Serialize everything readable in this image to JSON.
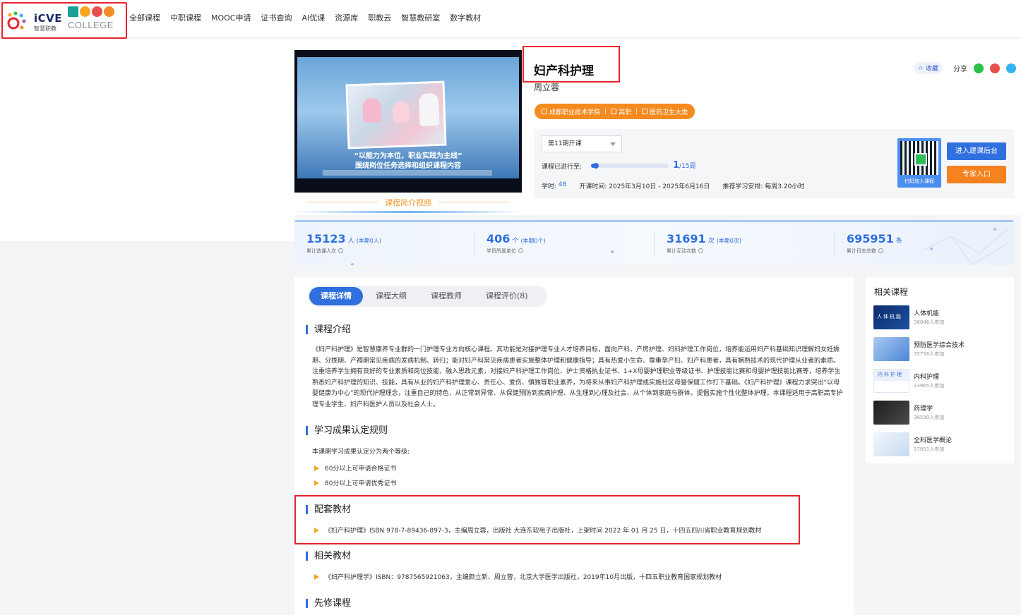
{
  "logo": {
    "icve_text": "iCVE",
    "icve_sub": "智慧职教",
    "mooc_text": "MOOC",
    "college_text": "COLLEGE"
  },
  "nav": [
    "全部课程",
    "中职课程",
    "MOOC申请",
    "证书查询",
    "AI优课",
    "资源库",
    "职教云",
    "智慧教研室",
    "数字教材"
  ],
  "video": {
    "caption_line1": "“以能力为本位，职业实践为主线”",
    "caption_line2": "围绕岗位任务选择和组织课程内容",
    "title": "课程简介视频"
  },
  "course": {
    "title": "妇产科护理",
    "teacher": "周立蓉",
    "tags": [
      "成都职业技术学院",
      "高职",
      "医药卫生大类"
    ],
    "favorite": "收藏",
    "share": "分享"
  },
  "session": {
    "selected": "第11期开课",
    "progress_label": "课程已进行至:",
    "progress_fraction": 0.0667,
    "progress_current": "1",
    "progress_total": "/15周",
    "hours_label": "学时:",
    "hours_value": "48",
    "open_time": "开课时间: 2025年3月10日 - 2025年6月16日",
    "suggest": "推荐学习安排: 每周3.20小时"
  },
  "qr": {
    "text": "扫码加入课程"
  },
  "buttons": {
    "backend": "进入建课后台",
    "expert": "专家入口"
  },
  "stats": [
    {
      "num": "15123",
      "unit": "人",
      "sub": "(本期0人)",
      "label": "累计选课人次"
    },
    {
      "num": "406",
      "unit": "个",
      "sub": "(本期0个)",
      "label": "学员所属单位"
    },
    {
      "num": "31691",
      "unit": "次",
      "sub": "(本期0次)",
      "label": "累计互动次数"
    },
    {
      "num": "695951",
      "unit": "条",
      "sub": "",
      "label": "累计日志总数"
    }
  ],
  "tabs": [
    "课程详情",
    "课程大纲",
    "课程教师",
    "课程评价(8)"
  ],
  "sections": {
    "intro_title": "课程介绍",
    "intro_text": "《妇产科护理》是智慧康养专业群的一门护理专业方向核心课程。其功能是对接护理专业人才培养目标，面向产科、产房护理、妇科护理工作岗位，培养能运用妇产科基础知识理解妇女妊娠期、分娩期、产褥期常见疾病的发病机制、转归；能对妇产科常见疾病患者实施整体护理和健康指导；具有热爱小生命、尊重孕产妇、妇产科患者，具有娴熟技术的现代护理从业者的素质。注重培养学生拥有良好的专业素质和岗位技能，融入思政元素，对接妇产科护理工作岗位、护士资格执业证书、1+X母婴护理职业等级证书、护理技能比赛和母婴护理技能比赛等，培养学生熟悉妇产科护理的知识、技能，具有从业的妇产科护理爱心、责任心、爱伤、慎独等职业素养，为将来从事妇产科护理或实施社区母婴保健工作打下基础。《妇产科护理》课程力求突出“以母婴健康为中心”的现代护理理念，注重自己的特色，从正常到异常、从保健预防到疾病护理、从生理到心理及社会、从个体到家庭与群体，提倡实施个性化整体护理。本课程适用于高职高专护理专业学生、妇产科医护人员以及社会人士。",
    "rule_title": "学习成果认定规则",
    "rule_intro": "本课期学习成果认定分为两个等级:",
    "rules": [
      "60分以上可申请合格证书",
      "80分以上可申请优秀证书"
    ],
    "textbook_title": "配套教材",
    "textbook_item": "《妇产科护理》ISBN 978-7-89436-897-3，主编周立蓉，出版社 大连东软电子出版社，上架时间 2022 年 01 月 25 日，十四五四川省职业教育规划教材",
    "related_title": "相关教材",
    "related_item": "《妇产科护理学》ISBN：9787565921063，主编颜立新、周立蓉，北京大学医学出版社，2019年10月出版，十四五职业教育国家规划教材",
    "prereq_title": "先修课程"
  },
  "side": {
    "title": "相关课程",
    "items": [
      {
        "name": "人体机能",
        "count": "38046人参加",
        "thumb_text": "人体机能"
      },
      {
        "name": "预防医学综合技术",
        "count": "35756人参加",
        "thumb_text": ""
      },
      {
        "name": "内科护理",
        "count": "33965人参加",
        "thumb_text": "内科护理"
      },
      {
        "name": "药理学",
        "count": "38590人参加",
        "thumb_text": ""
      },
      {
        "name": "全科医学概论",
        "count": "57891人参加",
        "thumb_text": ""
      }
    ]
  },
  "colors": {
    "primary": "#2f6fde",
    "orange": "#f58a1f",
    "highlight": "#e8232e"
  }
}
